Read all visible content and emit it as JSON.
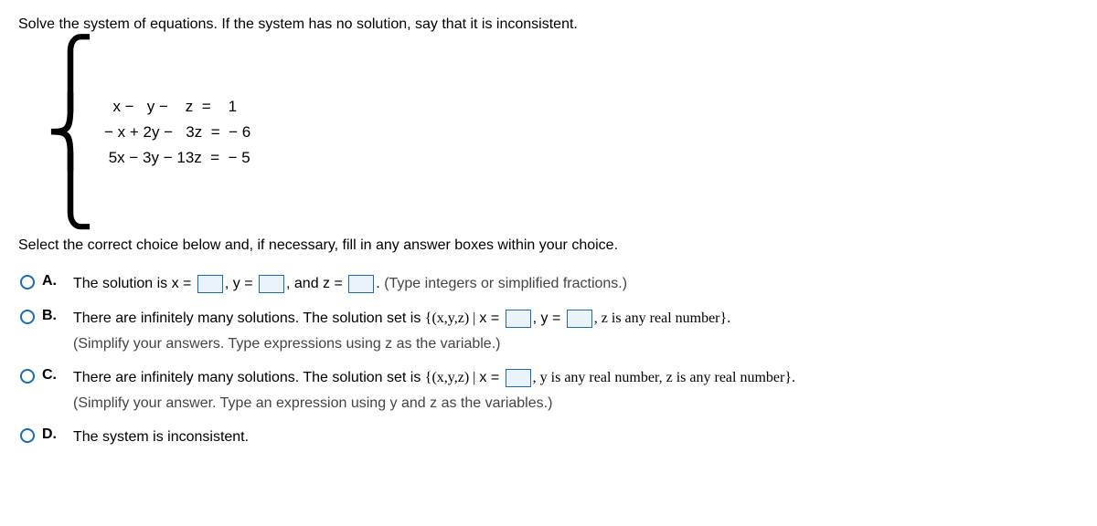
{
  "question": "Solve the system of equations. If the system has no solution, say that it is inconsistent.",
  "eq1": "  x −   y −    z  =    1",
  "eq2": "− x + 2y −   3z  =  − 6",
  "eq3": " 5x − 3y − 13z  =  − 5",
  "subprompt": "Select the correct choice below and, if necessary, fill in any answer boxes within your choice.",
  "A": {
    "label": "A.",
    "p1": "The solution is x =",
    "p2": ", y =",
    "p3": ", and z =",
    "p4": ".",
    "hint": "(Type integers or simplified fractions.)"
  },
  "B": {
    "label": "B.",
    "p1": "There are infinitely many solutions. The solution set is ",
    "set_open": "{(x,y,z) | ",
    "p2": "x =",
    "p3": ", y =",
    "p4": ", z is any real number}.",
    "hint": "(Simplify your answers. Type expressions using z as the variable.)"
  },
  "C": {
    "label": "C.",
    "p1": "There are infinitely many solutions. The solution set is ",
    "set_open": "{(x,y,z) | ",
    "p2": "x =",
    "p3": ", y is any real number, z is any real number}.",
    "hint": "(Simplify your answer. Type an expression using y and z as the variables.)"
  },
  "D": {
    "label": "D.",
    "text": "The system is inconsistent."
  }
}
